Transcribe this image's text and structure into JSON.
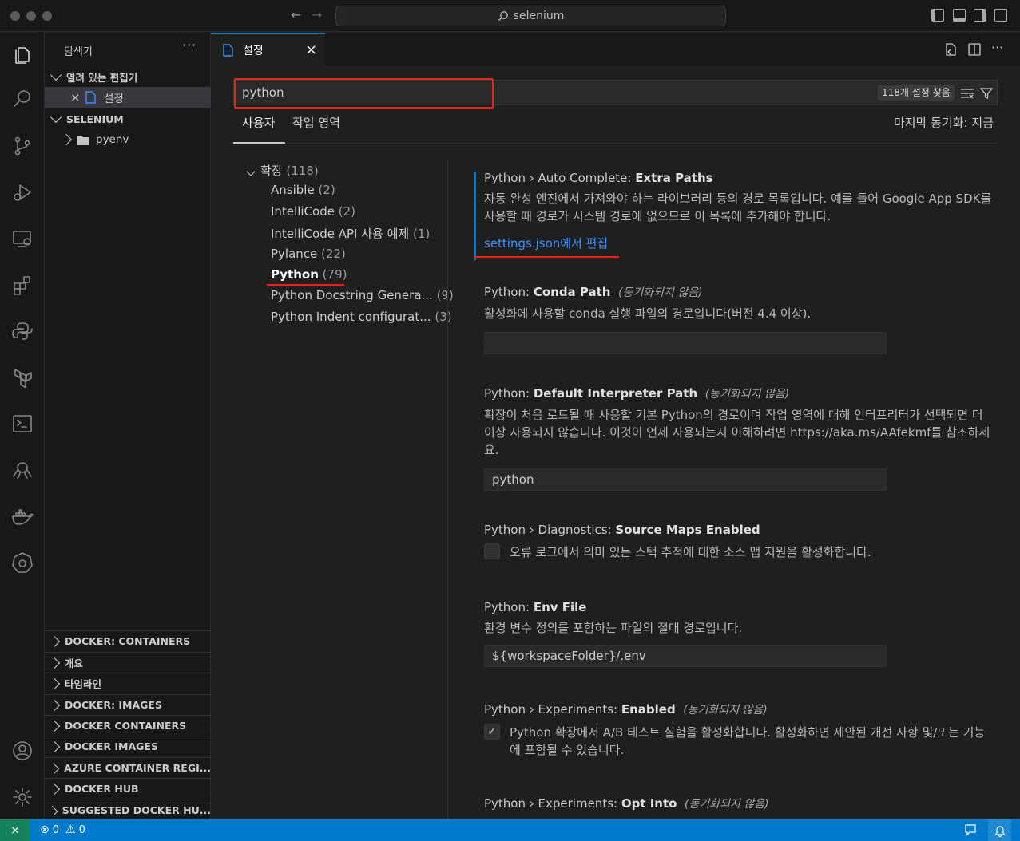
{
  "titlebar": {
    "search_text": "selenium"
  },
  "sidebar": {
    "title": "탐색기",
    "more": "···",
    "open_editors_label": "열려 있는 편집기",
    "open_editor_item": "설정",
    "folder_label": "SELENIUM",
    "folder_child": "pyenv",
    "sections": [
      "DOCKER: CONTAINERS",
      "개요",
      "타임라인",
      "DOCKER: IMAGES",
      "DOCKER CONTAINERS",
      "DOCKER IMAGES",
      "AZURE CONTAINER REGI...",
      "DOCKER HUB",
      "SUGGESTED DOCKER HU..."
    ]
  },
  "tab": {
    "label": "설정",
    "close": "×"
  },
  "settings": {
    "search_value": "python",
    "result_count": "118개 설정 찾음",
    "tabs": {
      "user": "사용자",
      "workspace": "작업 영역"
    },
    "last_sync": "마지막 동기화: 지금",
    "toc": {
      "root": {
        "label": "확장",
        "count": "(118)"
      },
      "items": [
        {
          "label": "Ansible",
          "count": "(2)"
        },
        {
          "label": "IntelliCode",
          "count": "(2)"
        },
        {
          "label": "IntelliCode API 사용 예제",
          "count": "(1)"
        },
        {
          "label": "Pylance",
          "count": "(22)"
        },
        {
          "label": "Python",
          "count": "(79)"
        },
        {
          "label": "Python Docstring Genera...",
          "count": "(9)"
        },
        {
          "label": "Python Indent configurat...",
          "count": "(3)"
        }
      ]
    },
    "items": [
      {
        "prefix": "Python › Auto Complete: ",
        "name": "Extra Paths",
        "nosync": "",
        "desc": "자동 완성 엔진에서 가져와야 하는 라이브러리 등의 경로 목록입니다. 예를 들어 Google App SDK를 사용할 때 경로가 시스템 경로에 없으므로 이 목록에 추가해야 합니다.",
        "link": "settings.json에서 편집"
      },
      {
        "prefix": "Python: ",
        "name": "Conda Path",
        "nosync": "(동기화되지 않음)",
        "desc": "활성화에 사용할 conda 실행 파일의 경로입니다(버전 4.4 이상).",
        "value": ""
      },
      {
        "prefix": "Python: ",
        "name": "Default Interpreter Path",
        "nosync": "(동기화되지 않음)",
        "desc": "확장이 처음 로드될 때 사용할 기본 Python의 경로이며 작업 영역에 대해 인터프리터가 선택되면 더 이상 사용되지 않습니다. 이것이 언제 사용되는지 이해하려면 https://aka.ms/AAfekmf를 참조하세요.",
        "value": "python"
      },
      {
        "prefix": "Python › Diagnostics: ",
        "name": "Source Maps Enabled",
        "nosync": "",
        "desc": "오류 로그에서 의미 있는 스택 추적에 대한 소스 맵 지원을 활성화합니다.",
        "checked": false
      },
      {
        "prefix": "Python: ",
        "name": "Env File",
        "nosync": "",
        "desc": "환경 변수 정의를 포함하는 파일의 절대 경로입니다.",
        "value": "${workspaceFolder}/.env"
      },
      {
        "prefix": "Python › Experiments: ",
        "name": "Enabled",
        "nosync": "(동기화되지 않음)",
        "desc": "Python 확장에서 A/B 테스트 실험을 활성화합니다. 활성화하면 제안된 개선 사항 및/또는 기능에 포함될 수 있습니다.",
        "checked": true
      },
      {
        "prefix": "Python › Experiments: ",
        "name": "Opt Into",
        "nosync": "(동기화되지 않음)"
      }
    ]
  },
  "statusbar": {
    "errors": "0",
    "warnings": "0"
  },
  "colors": {
    "accent": "#0078d4",
    "status": "#007acc",
    "highlight": "#e3261a",
    "link": "#3794ff"
  }
}
